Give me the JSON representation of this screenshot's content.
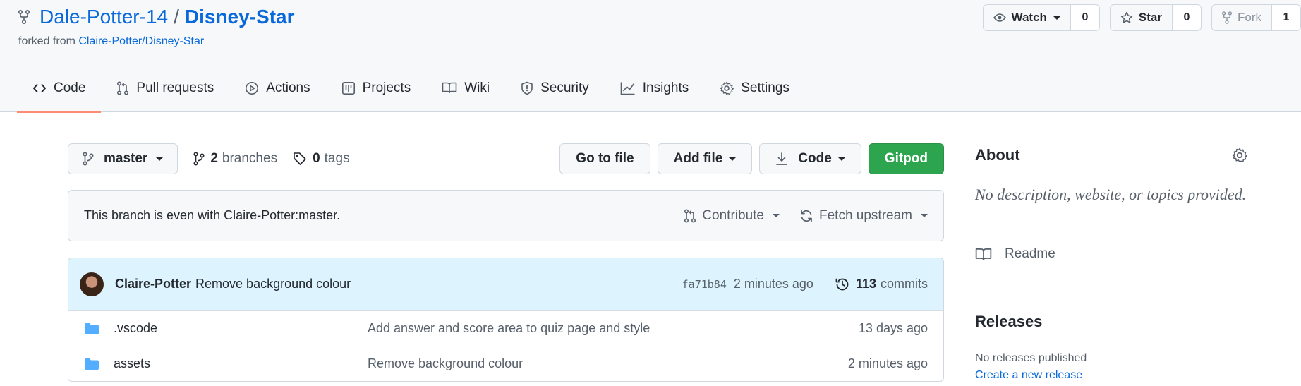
{
  "repo": {
    "owner": "Dale-Potter-14",
    "separator": "/",
    "name": "Disney-Star",
    "forked_prefix": "forked from",
    "forked_from": "Claire-Potter/Disney-Star"
  },
  "actions": {
    "watch_label": "Watch",
    "watch_count": "0",
    "star_label": "Star",
    "star_count": "0",
    "fork_label": "Fork",
    "fork_count": "1"
  },
  "tabs": [
    {
      "label": "Code",
      "icon": "code-icon",
      "active": true
    },
    {
      "label": "Pull requests",
      "icon": "pull-request-icon"
    },
    {
      "label": "Actions",
      "icon": "play-icon"
    },
    {
      "label": "Projects",
      "icon": "table-icon"
    },
    {
      "label": "Wiki",
      "icon": "book-icon"
    },
    {
      "label": "Security",
      "icon": "shield-icon"
    },
    {
      "label": "Insights",
      "icon": "graph-icon"
    },
    {
      "label": "Settings",
      "icon": "gear-icon"
    }
  ],
  "toolbar": {
    "branch": "master",
    "branches_count": "2",
    "branches_label": "branches",
    "tags_count": "0",
    "tags_label": "tags",
    "go_to_file": "Go to file",
    "add_file": "Add file",
    "code": "Code",
    "gitpod": "Gitpod"
  },
  "branch_status": {
    "message": "This branch is even with Claire-Potter:master.",
    "contribute": "Contribute",
    "fetch_upstream": "Fetch upstream"
  },
  "latest_commit": {
    "author": "Claire-Potter",
    "message": "Remove background colour",
    "sha": "fa71b84",
    "time": "2 minutes ago",
    "commits_count": "113",
    "commits_label": "commits"
  },
  "files": [
    {
      "name": ".vscode",
      "message": "Add answer and score area to quiz page and style",
      "age": "13 days ago"
    },
    {
      "name": "assets",
      "message": "Remove background colour",
      "age": "2 minutes ago"
    }
  ],
  "sidebar": {
    "about_title": "About",
    "description": "No description, website, or topics provided.",
    "readme": "Readme",
    "releases_title": "Releases",
    "no_releases": "No releases published",
    "create_release": "Create a new release"
  },
  "colors": {
    "link": "#0969da",
    "green_button": "#2da44e",
    "tab_underline": "#fd8c73",
    "folder": "#54aeff"
  }
}
